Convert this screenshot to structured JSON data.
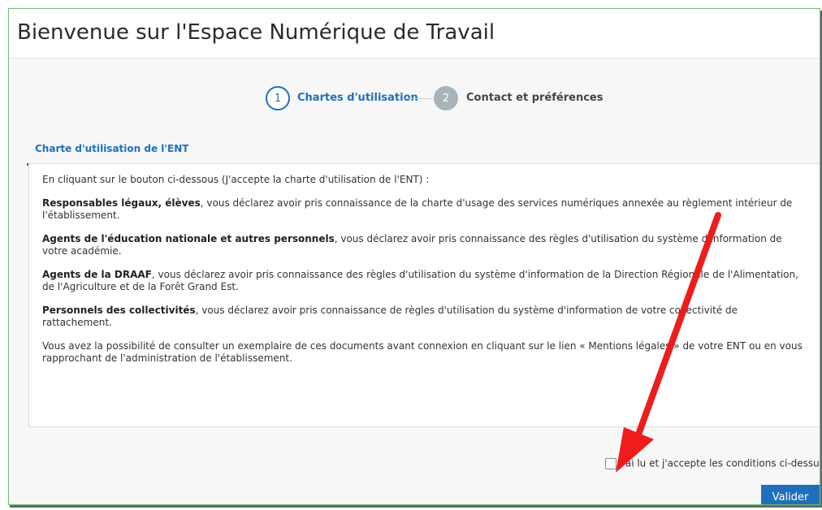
{
  "header": {
    "title": "Bienvenue sur l'Espace Numérique de Travail"
  },
  "stepper": {
    "steps": [
      {
        "number": "1",
        "label": "Chartes d'utilisation",
        "state": "active"
      },
      {
        "number": "2",
        "label": "Contact et préférences",
        "state": "inactive"
      }
    ]
  },
  "tab": {
    "label": "Charte d'utilisation de l'ENT"
  },
  "charter": {
    "intro": "En cliquant sur le bouton ci-dessous (J'accepte la charte d'utilisation de l'ENT) :",
    "paragraphs": [
      {
        "bold": "Responsables légaux, élèves",
        "text": ", vous déclarez avoir pris connaissance de la charte d'usage des services numériques annexée au règlement intérieur de l'établissement."
      },
      {
        "bold": "Agents de l'éducation nationale et autres personnels",
        "text": ", vous déclarez avoir pris connaissance des règles d'utilisation du système d'information de votre académie."
      },
      {
        "bold": "Agents de la DRAAF",
        "text": ", vous déclarez avoir pris connaissance des règles d'utilisation du système d'information de la Direction Régionale de l'Alimentation, de l'Agriculture et de la Forêt Grand Est."
      },
      {
        "bold": "Personnels des collectivités",
        "text": ", vous déclarez avoir pris connaissance de règles d'utilisation du système d'information de votre collectivité de rattachement."
      }
    ],
    "closing": "Vous avez la possibilité de consulter un exemplaire de ces documents avant connexion en cliquant sur le lien « Mentions légales » de votre ENT ou en vous rapprochant de l'administration de l'établissement."
  },
  "accept": {
    "label": "J'ai lu et j'accepte les conditions ci-dessus",
    "checked": false
  },
  "actions": {
    "validate_label": "Valider"
  },
  "colors": {
    "accent": "#1f6fbd",
    "annotation_arrow": "#ee1c1c",
    "inactive_step": "#a9b3ba"
  }
}
